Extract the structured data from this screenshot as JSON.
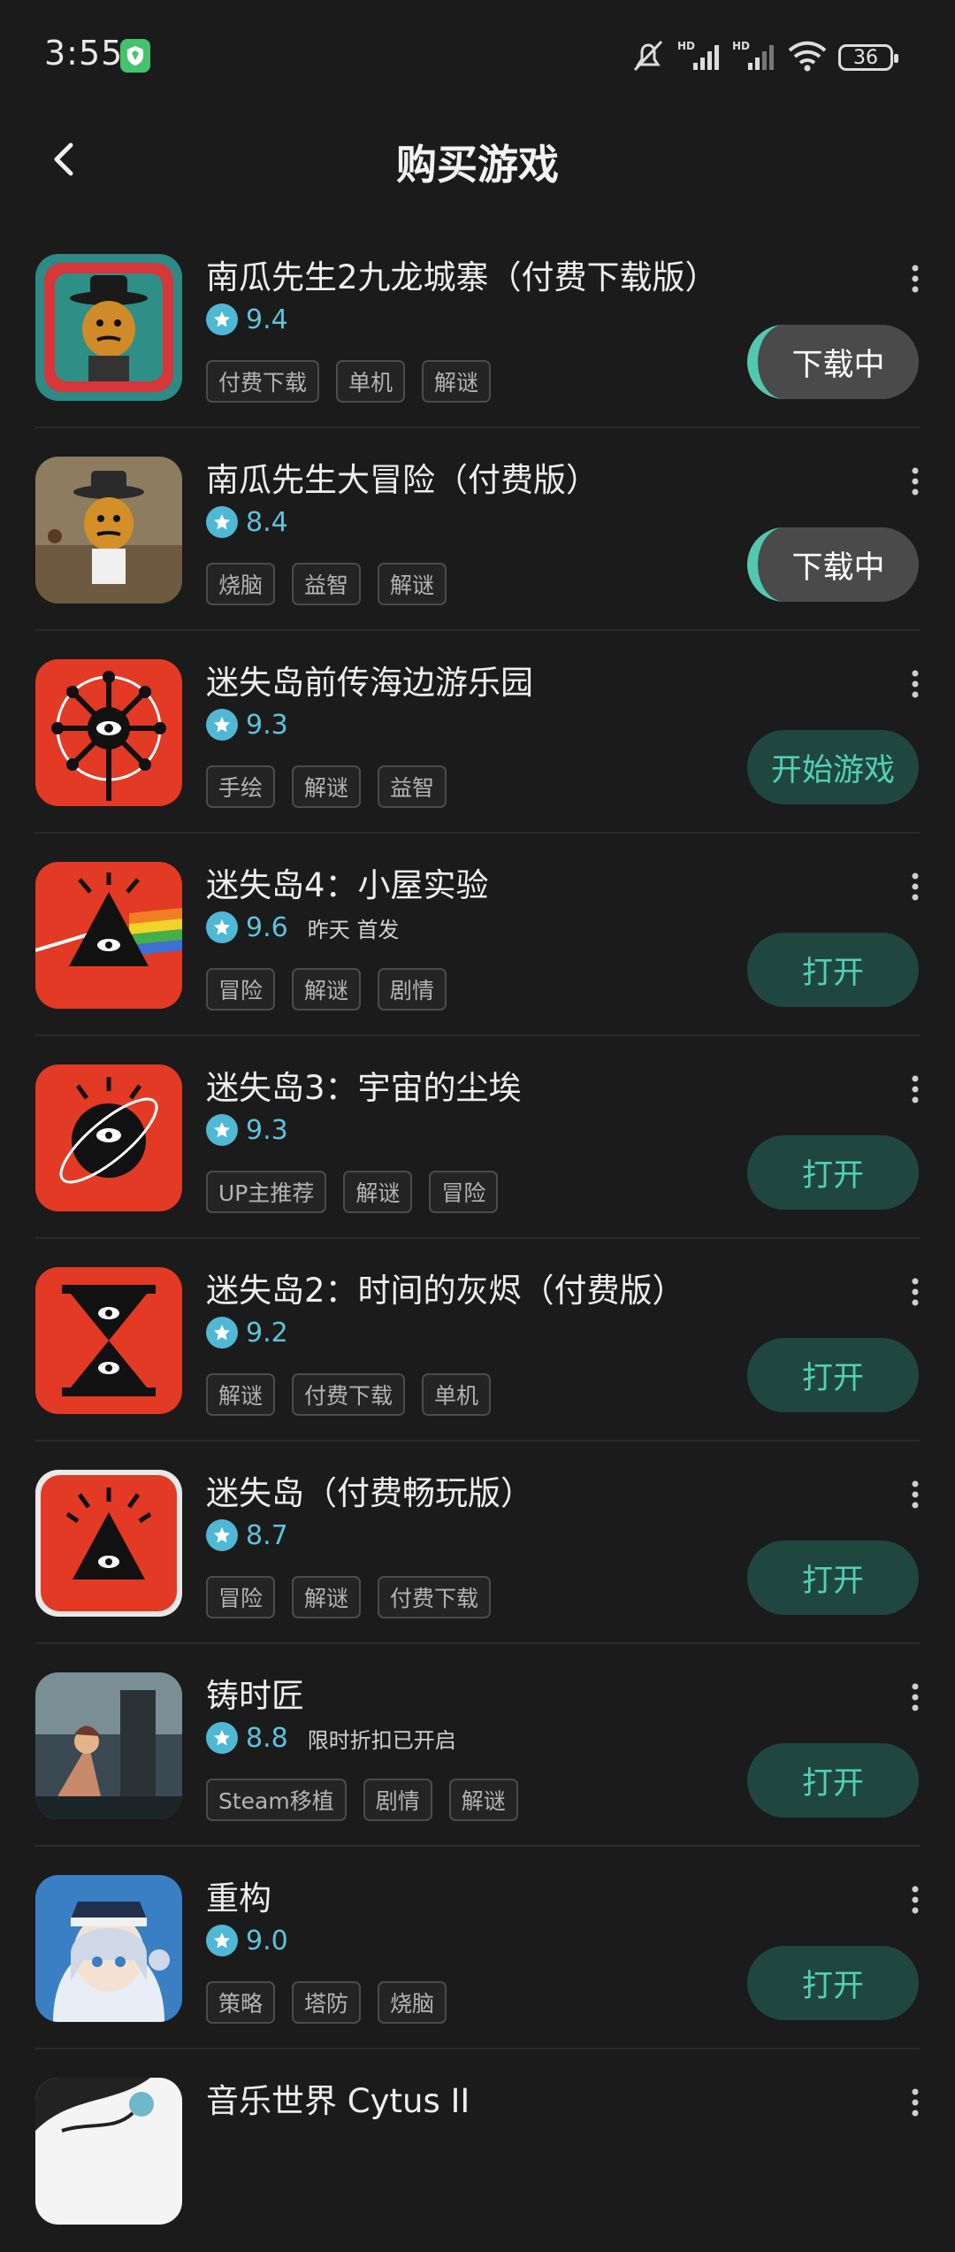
{
  "status_bar": {
    "time": "3:55",
    "battery": "36",
    "network": "HD"
  },
  "header": {
    "title": "购买游戏"
  },
  "games": [
    {
      "name": "南瓜先生2九龙城寨（付费下载版）",
      "score": "9.4",
      "note": "",
      "tags": [
        "付费下载",
        "单机",
        "解谜"
      ],
      "action": "下载中",
      "action_type": "downloading"
    },
    {
      "name": "南瓜先生大冒险（付费版）",
      "score": "8.4",
      "note": "",
      "tags": [
        "烧脑",
        "益智",
        "解谜"
      ],
      "action": "下载中",
      "action_type": "downloading"
    },
    {
      "name": "迷失岛前传海边游乐园",
      "score": "9.3",
      "note": "",
      "tags": [
        "手绘",
        "解谜",
        "益智"
      ],
      "action": "开始游戏",
      "action_type": "start"
    },
    {
      "name": "迷失岛4：小屋实验",
      "score": "9.6",
      "note": "昨天 首发",
      "tags": [
        "冒险",
        "解谜",
        "剧情"
      ],
      "action": "打开",
      "action_type": "open"
    },
    {
      "name": "迷失岛3：宇宙的尘埃",
      "score": "9.3",
      "note": "",
      "tags": [
        "UP主推荐",
        "解谜",
        "冒险"
      ],
      "action": "打开",
      "action_type": "open"
    },
    {
      "name": "迷失岛2：时间的灰烬（付费版）",
      "score": "9.2",
      "note": "",
      "tags": [
        "解谜",
        "付费下载",
        "单机"
      ],
      "action": "打开",
      "action_type": "open"
    },
    {
      "name": "迷失岛（付费畅玩版）",
      "score": "8.7",
      "note": "",
      "tags": [
        "冒险",
        "解谜",
        "付费下载"
      ],
      "action": "打开",
      "action_type": "open"
    },
    {
      "name": "铸时匠",
      "score": "8.8",
      "note": "限时折扣已开启",
      "tags": [
        "Steam移植",
        "剧情",
        "解谜"
      ],
      "action": "打开",
      "action_type": "open"
    },
    {
      "name": "重构",
      "score": "9.0",
      "note": "",
      "tags": [
        "策略",
        "塔防",
        "烧脑"
      ],
      "action": "打开",
      "action_type": "open"
    },
    {
      "name": "音乐世界 Cytus II",
      "score": "",
      "note": "",
      "tags": [],
      "action": "",
      "action_type": ""
    }
  ],
  "colors": {
    "accent": "#54d0b4",
    "star": "#4fb8d4",
    "background": "#1b1b1b"
  }
}
